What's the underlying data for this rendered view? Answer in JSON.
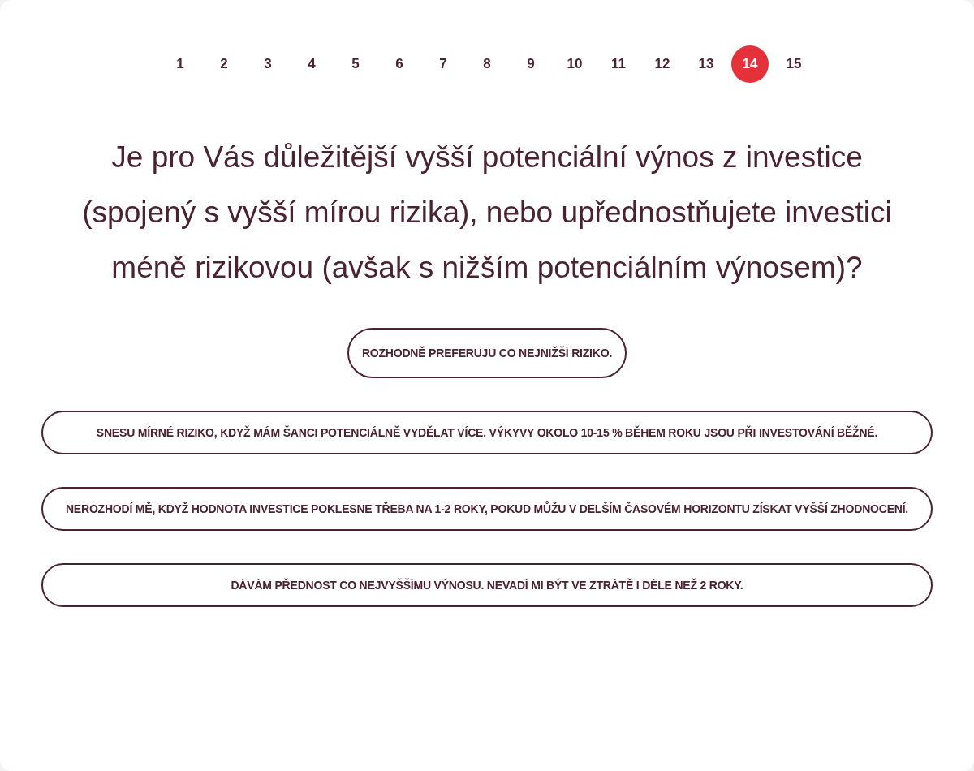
{
  "pagination": [
    {
      "label": "1",
      "selected": false
    },
    {
      "label": "2",
      "selected": false
    },
    {
      "label": "3",
      "selected": false
    },
    {
      "label": "4",
      "selected": false
    },
    {
      "label": "5",
      "selected": false
    },
    {
      "label": "6",
      "selected": false
    },
    {
      "label": "7",
      "selected": false
    },
    {
      "label": "8",
      "selected": false
    },
    {
      "label": "9",
      "selected": false
    },
    {
      "label": "10",
      "selected": false
    },
    {
      "label": "11",
      "selected": false
    },
    {
      "label": "12",
      "selected": false
    },
    {
      "label": "13",
      "selected": false
    },
    {
      "label": "14",
      "selected": true
    },
    {
      "label": "15",
      "selected": false
    }
  ],
  "question": "Je pro Vás důležitější vyšší potenciální výnos z investice (spojený s vyšší mírou rizika), nebo upřednostňujete investici méně rizikovou (avšak s nižším potenciálním výnosem)?",
  "answers": [
    {
      "label": "ROZHODNĚ PREFERUJU CO NEJNIŽŠÍ RIZIKO.",
      "selected": false
    },
    {
      "label": "SNESU MÍRNÉ RIZIKO, KDYŽ MÁM ŠANCI POTENCIÁLNĚ VYDĚLAT VÍCE. VÝKYVY OKOLO 10-15 % BĚHEM ROKU JSOU PŘI INVESTOVÁNÍ BĚŽNÉ.",
      "selected": false
    },
    {
      "label": "NEROZHODÍ MĚ, KDYŽ HODNOTA INVESTICE POKLESNE TŘEBA NA 1-2 ROKY, POKUD MŮŽU V DELŠÍM ČASOVÉM HORIZONTU ZÍSKAT VYŠŠÍ ZHODNOCENÍ.",
      "selected": false
    },
    {
      "label": "DÁVÁM PŘEDNOST CO NEJVYŠŠÍMU VÝNOSU. NEVADÍ MI BÝT VE ZTRÁTĚ I DÉLE NEŽ 2 ROKY.",
      "selected": false
    }
  ]
}
